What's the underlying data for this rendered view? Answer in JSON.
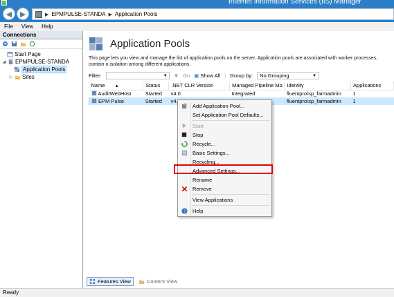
{
  "window": {
    "title": "Internet Information Services (IIS) Manager"
  },
  "address": {
    "server": "EPMPULSE-STANDA",
    "page": "Application Pools"
  },
  "menu": [
    "File",
    "View",
    "Help"
  ],
  "connections": {
    "header": "Connections",
    "tree": [
      {
        "label": "Start Page"
      },
      {
        "label": "EPMPULSE-STANDA"
      },
      {
        "label": "Application Pools"
      },
      {
        "label": "Sites"
      }
    ]
  },
  "main": {
    "title": "Application Pools",
    "description": "This page lets you view and manage the list of application pools on the server. Application pools are associated with worker processes, contain o isolation among different applications.",
    "filter": {
      "label": "Filter:",
      "go": "Go",
      "show_all": "Show All",
      "group_by_label": "Group by:",
      "group_by_value": "No Grouping"
    },
    "columns": [
      "Name",
      "Status",
      ".NET CLR Version",
      "Managed Pipeline Mo...",
      "Identity",
      "Applications"
    ],
    "rows": [
      {
        "name": "AuditWebHost",
        "status": "Started",
        "clr": "v4.0",
        "pipeline": "Integrated",
        "identity": "fluentpro\\sp_farmadmin",
        "apps": "1"
      },
      {
        "name": "EPM Pulse",
        "status": "Started",
        "clr": "v4.0",
        "pipeline": "Integrated",
        "identity": "fluentpro\\sp_farmadmin",
        "apps": "1"
      }
    ]
  },
  "context_menu": {
    "items": [
      {
        "label": "Add Application Pool...",
        "icon": "add-pool-icon"
      },
      {
        "label": "Set Application Pool Defaults...",
        "icon": ""
      },
      {
        "label": "Start",
        "icon": "start-icon"
      },
      {
        "label": "Stop",
        "icon": "stop-icon"
      },
      {
        "label": "Recycle...",
        "icon": "recycle-icon"
      },
      {
        "label": "Basic Settings...",
        "icon": "basic-settings-icon"
      },
      {
        "label": "Recycling...",
        "icon": ""
      },
      {
        "label": "Advanced Settings...",
        "icon": ""
      },
      {
        "label": "Rename",
        "icon": ""
      },
      {
        "label": "Remove",
        "icon": "remove-icon"
      },
      {
        "label": "View Applications",
        "icon": ""
      },
      {
        "label": "Help",
        "icon": "help-icon"
      }
    ]
  },
  "tabs": {
    "features": "Features View",
    "content": "Content View"
  },
  "status": "Ready",
  "colors": {
    "accent": "#2c7fc7",
    "selection": "#cce8ff",
    "highlight": "#e00000"
  }
}
